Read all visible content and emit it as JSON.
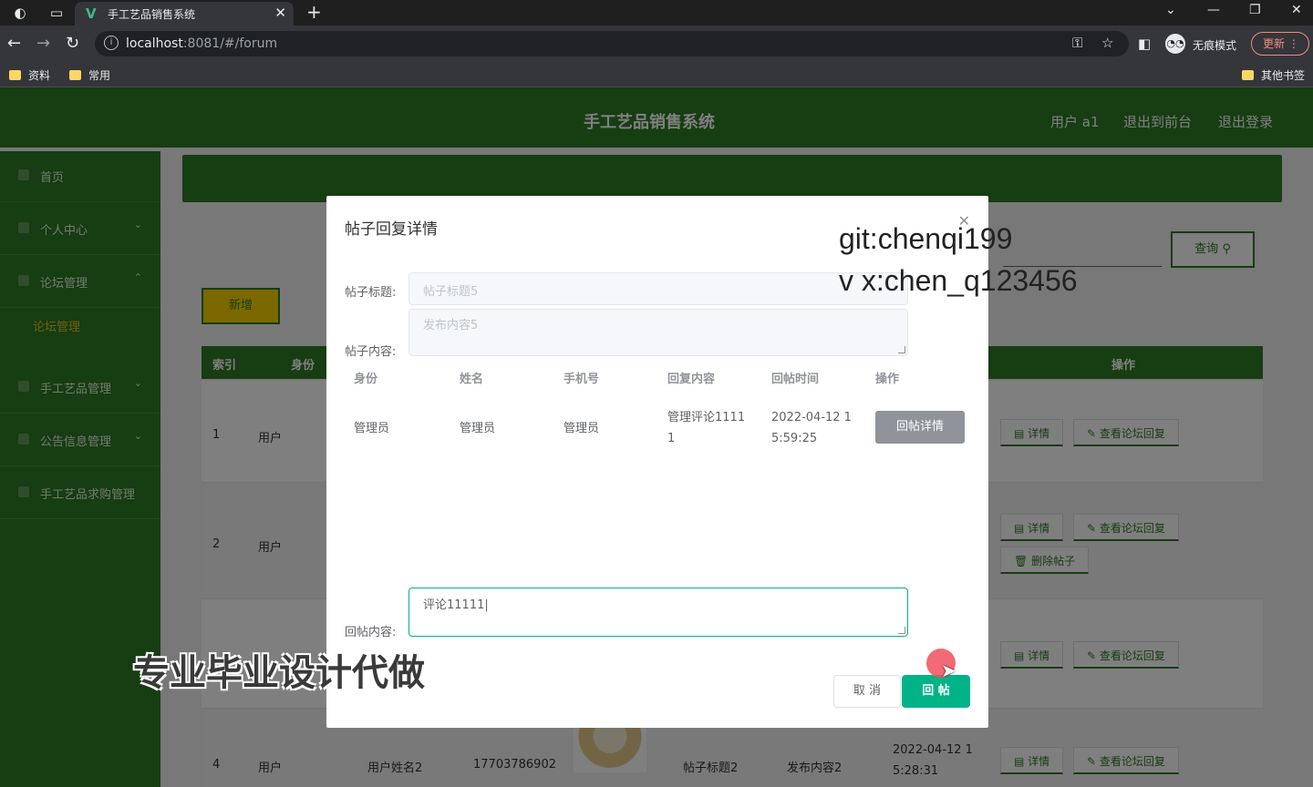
{
  "browser": {
    "tab_title": "手工艺品销售系统",
    "url_host": "localhost",
    "url_rest": ":8081/#/forum",
    "incognito_label": "无痕模式",
    "update_label": "更新",
    "bookmarks": [
      "资料",
      "常用"
    ],
    "other_bookmarks": "其他书签"
  },
  "header": {
    "title": "手工艺品销售系统",
    "user": "用户 a1",
    "back_front": "退出到前台",
    "logout": "退出登录"
  },
  "sidebar": {
    "items": [
      "首页",
      "个人中心",
      "论坛管理",
      "手工艺品管理",
      "公告信息管理",
      "手工艺品求购管理"
    ],
    "active_sub": "论坛管理"
  },
  "toolbar": {
    "query_label": "查询",
    "add_label": "新增"
  },
  "table": {
    "headers": [
      "索引",
      "身份",
      "操作"
    ],
    "rows": [
      {
        "index": "1",
        "role": "用户",
        "detail": "详情",
        "view_replies": "查看论坛回复"
      },
      {
        "index": "2",
        "role": "用户",
        "detail": "详情",
        "view_replies": "查看论坛回复",
        "delete": "删除帖子"
      },
      {
        "detail": "详情",
        "view_replies": "查看论坛回复"
      },
      {
        "index": "4",
        "role": "用户",
        "name": "用户姓名2",
        "phone": "17703786902",
        "title": "帖子标题2",
        "content": "发布内容2",
        "time_a": "2022-04-12 1",
        "time_b": "5:28:31",
        "detail": "详情",
        "view_replies": "查看论坛回复"
      }
    ]
  },
  "dialog": {
    "title": "帖子回复详情",
    "title_label": "帖子标题:",
    "title_value": "帖子标题5",
    "content_label": "帖子内容:",
    "content_value": "发布内容5",
    "reply_headers": [
      "身份",
      "姓名",
      "手机号",
      "回复内容",
      "回帖时间",
      "操作"
    ],
    "reply_row": {
      "role": "管理员",
      "name": "管理员",
      "phone": "管理员",
      "content_a": "管理评论1111",
      "content_b": "1",
      "time_a": "2022-04-12 1",
      "time_b": "5:59:25",
      "action": "回帖详情"
    },
    "reply_label": "回帖内容:",
    "reply_value": "评论11111|",
    "cancel_label": "取 消",
    "submit_label": "回 帖"
  },
  "overlay_text": {
    "watermark_line1": "git:chenqi199",
    "watermark_line2": "v x:chen_q123456",
    "promo": "专业毕业设计代做"
  }
}
